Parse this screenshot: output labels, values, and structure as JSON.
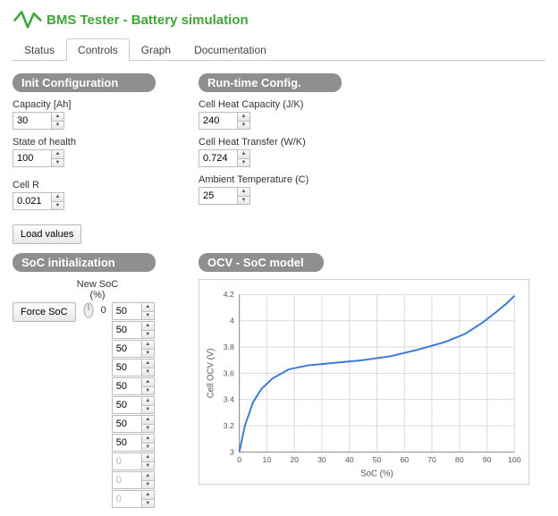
{
  "app_title": "BMS Tester - Battery simulation",
  "tabs": [
    "Status",
    "Controls",
    "Graph",
    "Documentation"
  ],
  "active_tab": 1,
  "init_config": {
    "header": "Init Configuration",
    "capacity_label": "Capacity [Ah]",
    "capacity_value": "30",
    "soh_label": "State of health",
    "soh_value": "100",
    "cellr_label": "Cell R",
    "cellr_value": "0.021",
    "load_button": "Load values"
  },
  "runtime_config": {
    "header": "Run-time Config.",
    "heat_cap_label": "Cell Heat Capacity (J/K)",
    "heat_cap_value": "240",
    "heat_transfer_label": "Cell Heat Transfer (W/K)",
    "heat_transfer_value": "0.724",
    "ambient_label": "Ambient Temperature (C)",
    "ambient_value": "25"
  },
  "soc_init": {
    "header": "SoC initialization",
    "force_button": "Force SoC",
    "knob_value": "0",
    "new_soc_label": "New SoC (%)",
    "values": [
      "50",
      "50",
      "50",
      "50",
      "50",
      "50",
      "50",
      "50",
      "0",
      "0",
      "0"
    ]
  },
  "ocv": {
    "header": "OCV - SoC model",
    "xlabel": "SoC (%)",
    "ylabel": "Cell OCV (V)"
  },
  "chart_data": {
    "type": "line",
    "title": "OCV - SoC model",
    "xlabel": "SoC (%)",
    "ylabel": "Cell OCV (V)",
    "xlim": [
      0,
      100
    ],
    "ylim": [
      3.0,
      4.2
    ],
    "x_ticks": [
      0,
      10,
      20,
      30,
      40,
      50,
      60,
      70,
      80,
      90,
      100
    ],
    "y_ticks": [
      3.0,
      3.2,
      3.4,
      3.6,
      3.8,
      4.0,
      4.2
    ],
    "x": [
      0,
      2,
      5,
      8,
      12,
      18,
      25,
      35,
      45,
      55,
      65,
      75,
      82,
      88,
      93,
      97,
      100
    ],
    "y": [
      3.0,
      3.2,
      3.38,
      3.48,
      3.56,
      3.63,
      3.66,
      3.68,
      3.7,
      3.73,
      3.78,
      3.84,
      3.9,
      3.98,
      4.06,
      4.13,
      4.19
    ]
  }
}
